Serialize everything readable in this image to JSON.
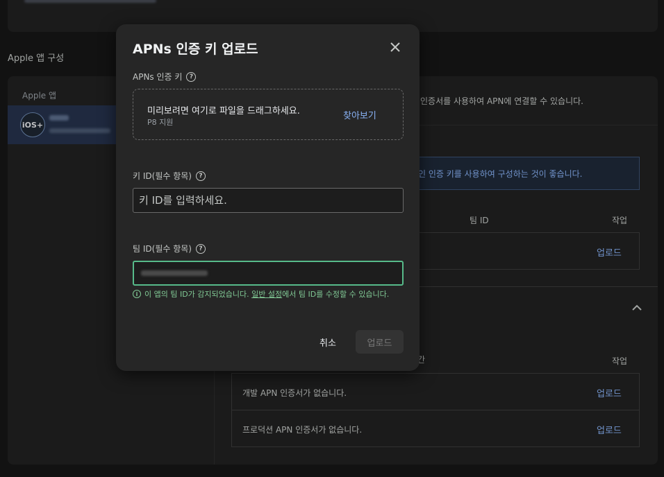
{
  "background": {
    "section_title": "Apple 앱 구성",
    "apps_header": "Apple 앱",
    "app_badge": "iOS+",
    "right_desc": "인증서를 사용하여 APN에 연결할 수 있습니다.",
    "info_text": "인 인증 키를 사용하여 구성하는 것이 좋습니다.",
    "col_team_id": "팀 ID",
    "col_action": "작업",
    "col_partial": "간",
    "upload_link": "업로드",
    "dev_cert_text": "개발 APN 인증서가 없습니다.",
    "prod_cert_text": "프로덕션 APN 인증서가 없습니다."
  },
  "dialog": {
    "title": "APNs 인증 키 업로드",
    "apns_key_label": "APNs 인증 키",
    "dropzone_main": "미리보려면 여기로 파일을 드래그하세요.",
    "dropzone_sub": "P8 지원",
    "browse_label": "찾아보기",
    "key_id_label": "키 ID(필수 항목)",
    "key_id_placeholder": "키 ID를 입력하세요.",
    "team_id_label": "팀 ID(필수 항목)",
    "hint_prefix": "이 앱의 팀 ID가 감지되었습니다.",
    "hint_link": "일반 설정",
    "hint_suffix": "에서 팀 ID를 수정할 수 있습니다.",
    "cancel_label": "취소",
    "upload_label": "업로드"
  },
  "colors": {
    "accent_blue": "#8ab4f8",
    "success_green": "#81c995",
    "focus_border": "#57bb8a"
  }
}
